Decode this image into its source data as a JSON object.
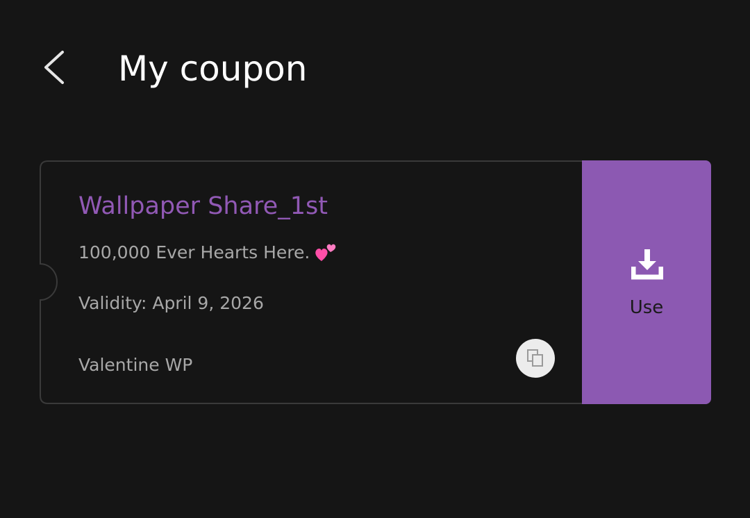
{
  "header": {
    "back_icon": "chevron-left-icon",
    "title": "My coupon"
  },
  "coupon": {
    "name": "Wallpaper Share_1st",
    "description": "100,000 Ever Hearts Here.",
    "description_emoji": "two-hearts-icon",
    "validity": "Validity: April 9, 2026",
    "tag": "Valentine WP",
    "copy_icon": "copy-icon",
    "use_icon": "download-icon",
    "use_label": "Use"
  },
  "colors": {
    "background": "#151515",
    "title": "#ffffff",
    "coupon_name": "#9159b5",
    "secondary_text": "#a8a8a8",
    "card_border": "#3a3a3a",
    "use_panel": "#8c59b2",
    "copy_button_bg": "#ececec",
    "heart_pink": "#ff4fa8"
  }
}
